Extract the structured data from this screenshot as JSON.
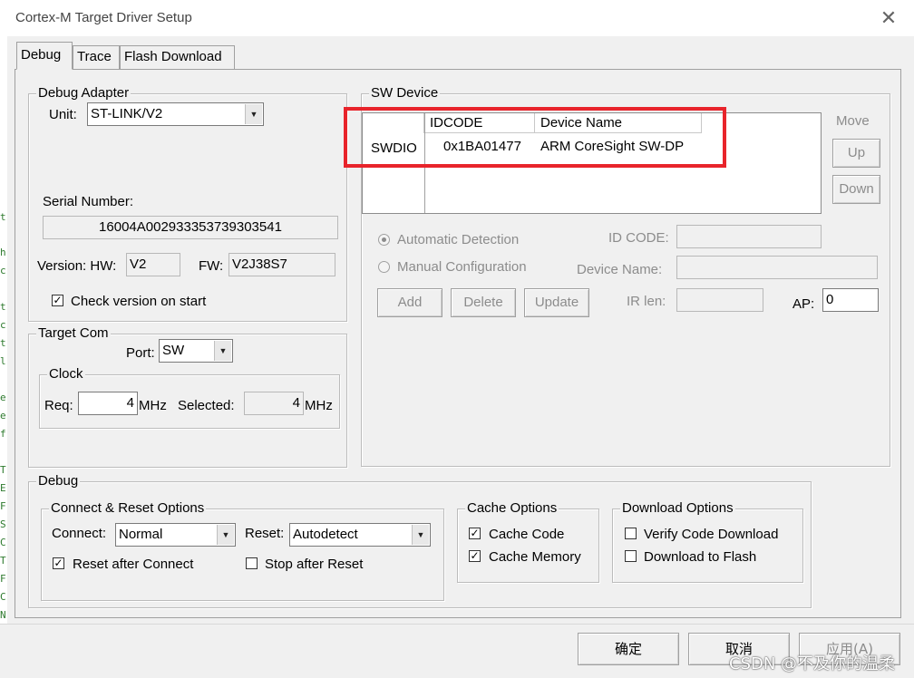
{
  "window": {
    "title": "Cortex-M Target Driver Setup",
    "close_glyph": "✕"
  },
  "tabs": [
    {
      "label": "Debug",
      "active": true
    },
    {
      "label": "Trace",
      "active": false
    },
    {
      "label": "Flash Download",
      "active": false
    }
  ],
  "debug_adapter": {
    "legend": "Debug Adapter",
    "unit_label": "Unit:",
    "unit_value": "ST-LINK/V2",
    "serial_label": "Serial Number:",
    "serial_value": "16004A002933353739303541",
    "version_label": "Version: HW:",
    "hw_value": "V2",
    "fw_label": "FW:",
    "fw_value": "V2J38S7",
    "check_version_label": "Check version on start",
    "check_version_checked": true
  },
  "target_com": {
    "legend": "Target Com",
    "port_label": "Port:",
    "port_value": "SW",
    "clock_legend": "Clock",
    "req_label": "Req:",
    "req_value": "4",
    "req_unit": "MHz",
    "selected_label": "Selected:",
    "selected_value": "4",
    "selected_unit": "MHz"
  },
  "sw_device": {
    "legend": "SW Device",
    "columns": [
      "IDCODE",
      "Device Name"
    ],
    "row_label": "SWDIO",
    "rows": [
      {
        "idcode": "0x1BA01477",
        "name": "ARM CoreSight SW-DP"
      }
    ],
    "move_label": "Move",
    "up_label": "Up",
    "down_label": "Down",
    "auto_detect_label": "Automatic Detection",
    "manual_config_label": "Manual Configuration",
    "id_code_label": "ID CODE:",
    "id_code_value": "",
    "device_name_label": "Device Name:",
    "device_name_value": "",
    "add_label": "Add",
    "delete_label": "Delete",
    "update_label": "Update",
    "ir_len_label": "IR len:",
    "ir_len_value": "",
    "ap_label": "AP:",
    "ap_value": "0"
  },
  "debug": {
    "legend": "Debug",
    "connect_reset": {
      "legend": "Connect & Reset Options",
      "connect_label": "Connect:",
      "connect_value": "Normal",
      "reset_label": "Reset:",
      "reset_value": "Autodetect",
      "reset_after_connect_label": "Reset after Connect",
      "reset_after_connect_checked": true,
      "stop_after_reset_label": "Stop after Reset",
      "stop_after_reset_checked": false
    },
    "cache": {
      "legend": "Cache Options",
      "cache_code_label": "Cache Code",
      "cache_code_checked": true,
      "cache_memory_label": "Cache Memory",
      "cache_memory_checked": true
    },
    "download": {
      "legend": "Download Options",
      "verify_label": "Verify Code Download",
      "verify_checked": false,
      "download_flash_label": "Download to Flash",
      "download_flash_checked": false
    }
  },
  "footer": {
    "ok_label": "确定",
    "cancel_label": "取消",
    "apply_label": "应用(A)"
  },
  "watermark": "CSDN @不及你的温柔",
  "left_strip_chars": [
    "t",
    "h",
    "c",
    "t",
    "c",
    "t",
    "l",
    "e",
    "e",
    "f",
    "T",
    "E",
    "F",
    "S",
    "C",
    "T",
    "F",
    "C",
    "N"
  ],
  "colors": {
    "highlight_box": "#e8242b",
    "dialog_bg": "#f0f0f0",
    "disabled_text": "#8c8c8c"
  }
}
